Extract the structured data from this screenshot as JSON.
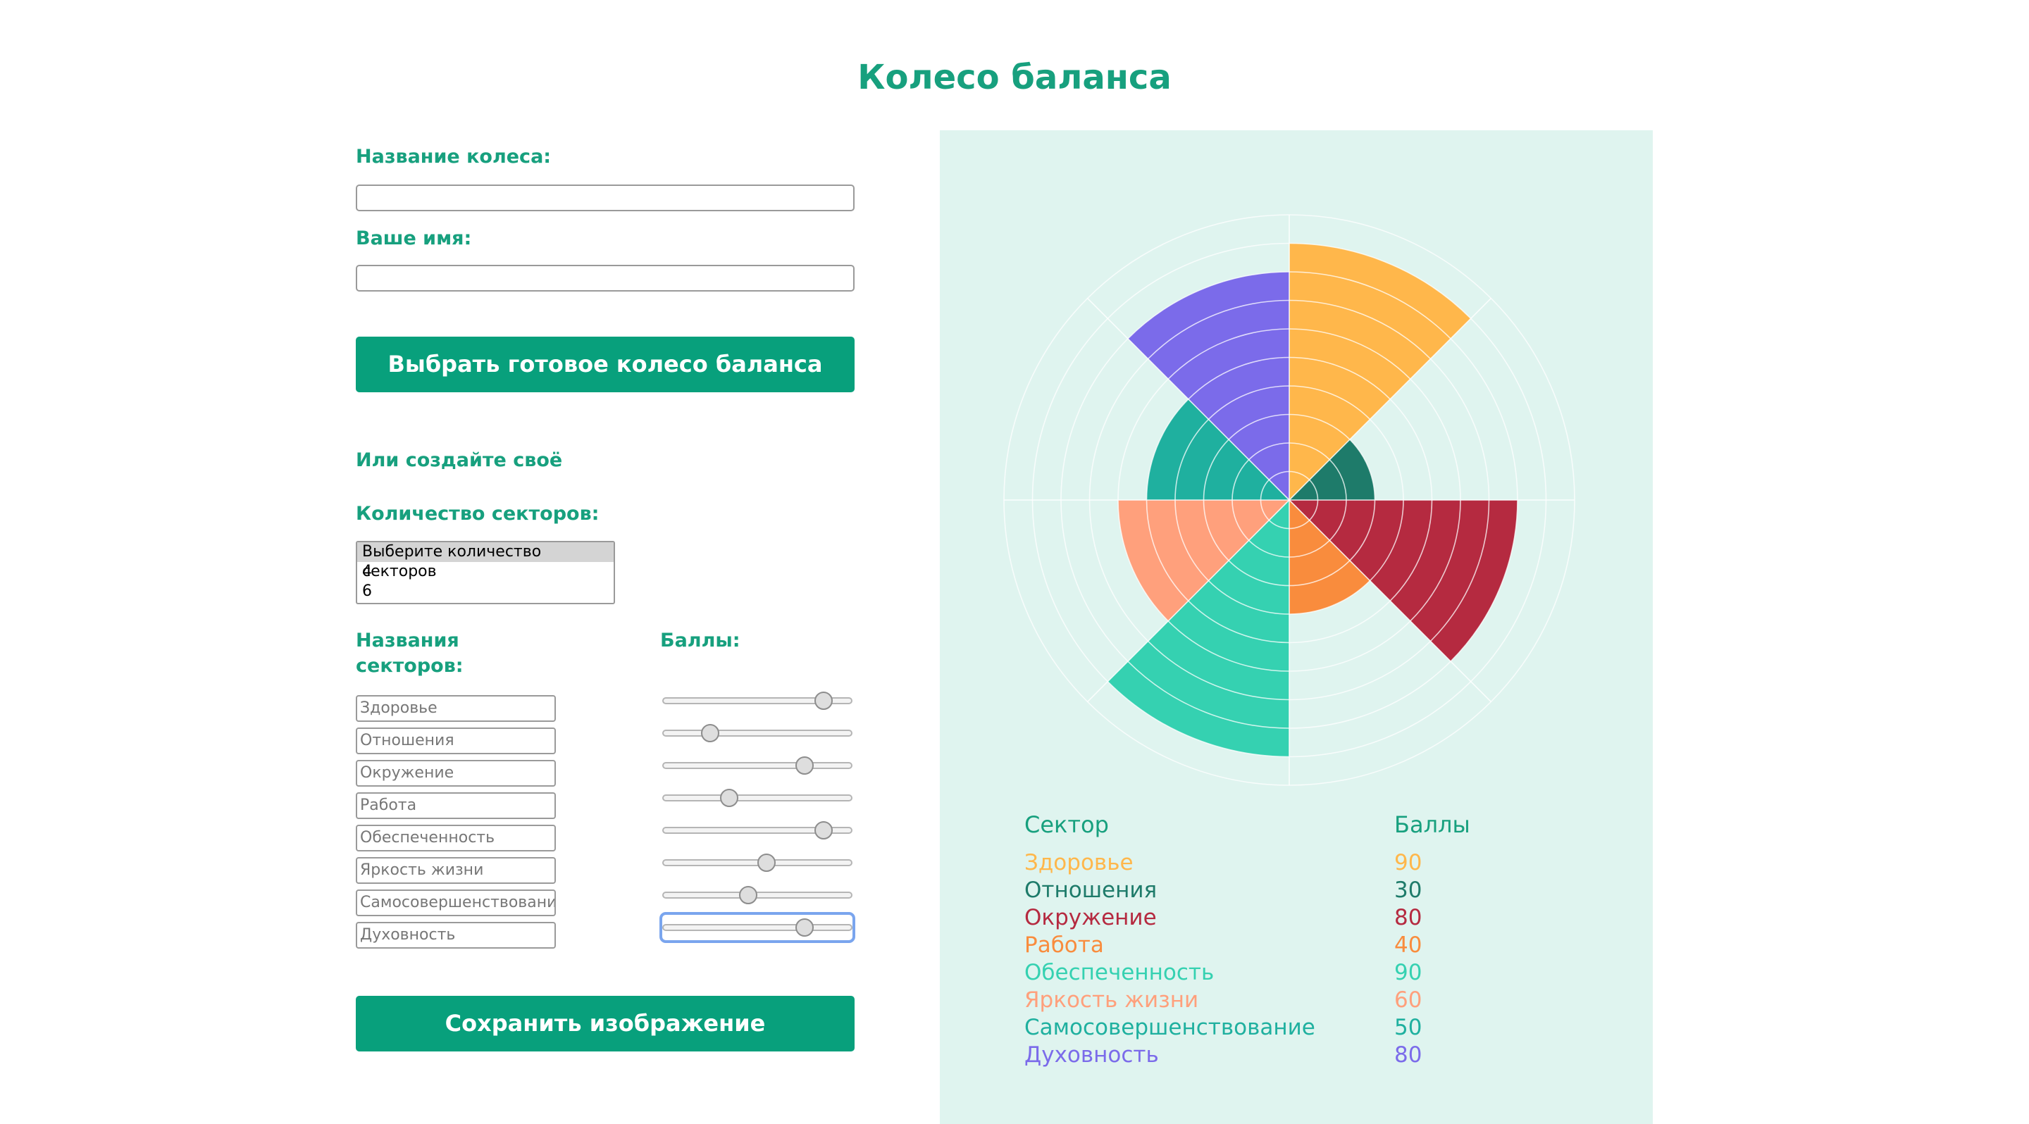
{
  "page": {
    "title": "Колесо баланса"
  },
  "form": {
    "wheel_name_label": "Название колеса:",
    "wheel_name_value": "",
    "your_name_label": "Ваше имя:",
    "your_name_value": "",
    "choose_button": "Выбрать готовое колесо баланса",
    "or_create_label": "Или создайте своё",
    "sectors_count_label": "Количество секторов:",
    "sectors_count_options": [
      "Выберите количество секторов",
      "4",
      "6"
    ],
    "sector_names_label": "Названия секторов:",
    "scores_label": "Баллы:",
    "save_button": "Сохранить изображение"
  },
  "sectors": [
    {
      "name": "Здоровье",
      "score": 90,
      "color": "#ffb74b"
    },
    {
      "name": "Отношения",
      "score": 30,
      "color": "#1e7b6a"
    },
    {
      "name": "Окружение",
      "score": 80,
      "color": "#b52a40"
    },
    {
      "name": "Работа",
      "score": 40,
      "color": "#f98c3d"
    },
    {
      "name": "Обеспеченность",
      "score": 90,
      "color": "#35d1b1"
    },
    {
      "name": "Яркость жизни",
      "score": 60,
      "color": "#ffa07c"
    },
    {
      "name": "Самосовершенствование",
      "score": 50,
      "color": "#1fb09f"
    },
    {
      "name": "Духовность",
      "score": 80,
      "color": "#7b6bea"
    }
  ],
  "legend": {
    "sector_header": "Сектор",
    "score_header": "Баллы"
  },
  "colors": {
    "accent": "#17a07e",
    "button": "#08a07c",
    "panel": "#dff4ef"
  }
}
